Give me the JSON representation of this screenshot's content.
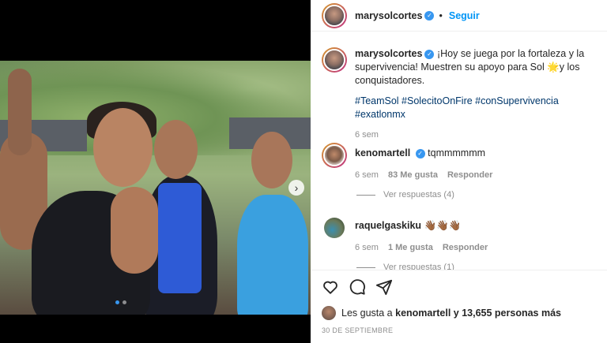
{
  "post": {
    "author": "marysolcortes",
    "follow_label": "Seguir",
    "caption_author": "marysolcortes",
    "caption": "¡Hoy se juega por la fortaleza y la supervivencia! Muestren su apoyo para Sol 🌟y los conquistadores.",
    "hashtags": "#TeamSol #SolecitoOnFire #conSupervivencia #exatlonmx",
    "caption_time": "6 sem"
  },
  "comments": [
    {
      "user": "kenomartell",
      "text": "tqmmmmmm",
      "time": "6 sem",
      "likes": "83 Me gusta",
      "reply_label": "Responder",
      "view_replies": "Ver respuestas (4)"
    },
    {
      "user": "raquelgaskiku",
      "text": "👋🏾👋🏾👋🏾",
      "time": "6 sem",
      "likes": "1 Me gusta",
      "reply_label": "Responder",
      "view_replies": "Ver respuestas (1)"
    }
  ],
  "likes_summary": {
    "prefix": "Les gusta a",
    "user": "kenomartell",
    "suffix": "y 13,655 personas más"
  },
  "date": "30 DE SEPTIEMBRE",
  "icons": [
    "heart-icon",
    "comment-icon",
    "share-icon",
    "chevron-right-icon",
    "verified-icon"
  ],
  "colors": {
    "link": "#0095f6",
    "hashtag": "#00376b",
    "meta": "#8e8e8e",
    "verified": "#3897f0"
  }
}
